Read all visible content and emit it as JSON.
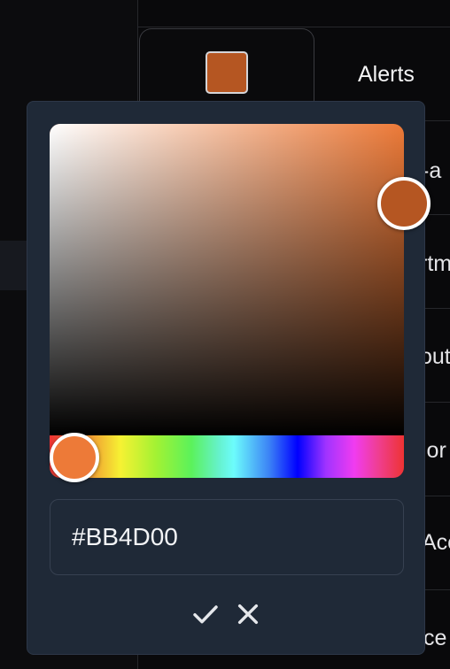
{
  "header": {
    "tab_label": "Alerts",
    "swatch_color": "#B55622"
  },
  "table": {
    "rows": [
      "-a",
      "rtm",
      "out",
      "ior",
      "Acc",
      "ce"
    ]
  },
  "picker": {
    "hex_value": "#BB4D00",
    "hue_color": "#ED7A38",
    "selected_color": "#B55622",
    "confirm_icon": "check-icon",
    "cancel_icon": "close-icon"
  }
}
